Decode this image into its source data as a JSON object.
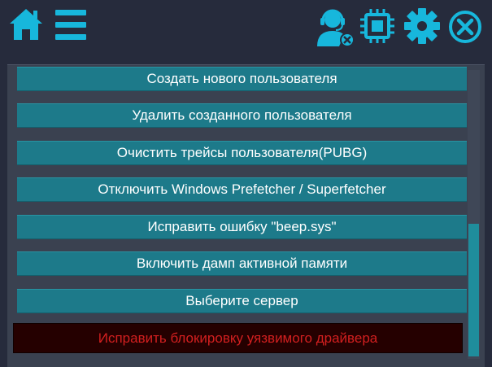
{
  "colors": {
    "accent": "#17b7dc",
    "background": "#262b3c",
    "panel": "#3a4150",
    "item": "#1d7a8a",
    "danger_bg": "#250000",
    "danger_text": "#d31f1f"
  },
  "toolbar": {
    "icons": [
      "home-icon",
      "menu-icon",
      "support-agent-icon",
      "cpu-chip-icon",
      "gear-icon",
      "close-circle-icon"
    ]
  },
  "actions": [
    "Создать нового пользователя",
    "Удалить созданного пользователя",
    "Очистить трейсы пользователя(PUBG)",
    "Отключить Windows Prefetcher / Superfetcher",
    "Исправить ошибку \"beep.sys\"",
    "Включить дамп активной памяти",
    "Выберите сервер"
  ],
  "danger_action": "Исправить блокировку уязвимого драйвера"
}
